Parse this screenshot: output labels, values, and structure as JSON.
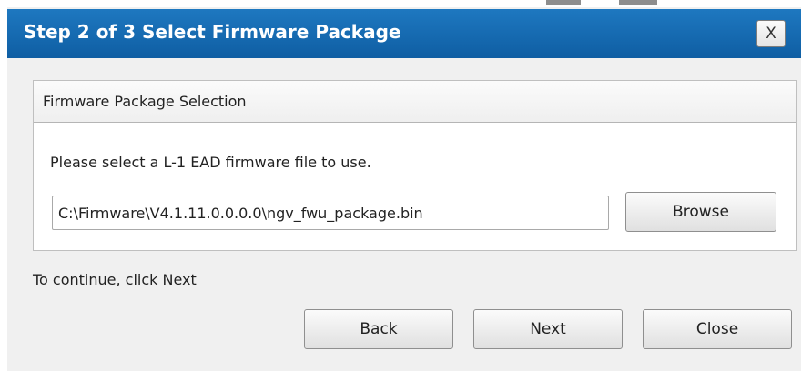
{
  "dialog": {
    "title": "Step 2 of 3 Select Firmware Package",
    "close_glyph": "X"
  },
  "group": {
    "header": "Firmware Package Selection",
    "instruction": "Please select a L-1 EAD firmware file to use.",
    "file_path": "C:\\Firmware\\V4.1.11.0.0.0.0\\ngv_fwu_package.bin",
    "browse_label": "Browse"
  },
  "footer": {
    "hint": "To continue, click Next",
    "back_label": "Back",
    "next_label": "Next",
    "close_label": "Close"
  },
  "colors": {
    "titlebar": "#1569B0",
    "dialog_bg": "#F0F0F0",
    "group_bg": "#FFFFFF"
  }
}
